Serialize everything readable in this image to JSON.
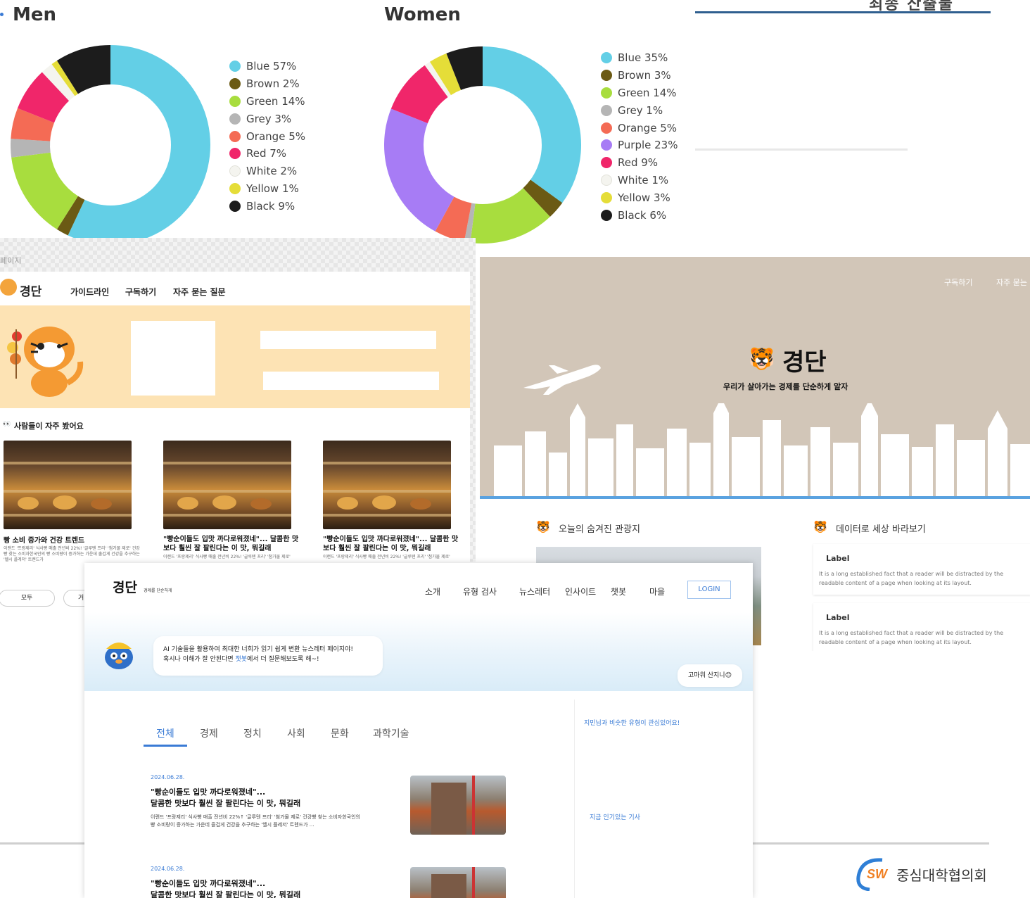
{
  "charts": {
    "men": {
      "title": "Men",
      "legend": [
        {
          "label": "Blue 57%",
          "color": "#63cfe6",
          "value": 57
        },
        {
          "label": "Brown 2%",
          "color": "#6b5a14",
          "value": 2
        },
        {
          "label": "Green 14%",
          "color": "#a8dd3e",
          "value": 14
        },
        {
          "label": "Grey 3%",
          "color": "#b5b5b5",
          "value": 3
        },
        {
          "label": "Orange 5%",
          "color": "#f46b55",
          "value": 5
        },
        {
          "label": "Red 7%",
          "color": "#f0266a",
          "value": 7
        },
        {
          "label": "White 2%",
          "color": "#f4f4ef",
          "value": 2
        },
        {
          "label": "Yellow 1%",
          "color": "#e5dd38",
          "value": 1
        },
        {
          "label": "Black 9%",
          "color": "#1c1c1c",
          "value": 9
        }
      ]
    },
    "women": {
      "title": "Women",
      "legend": [
        {
          "label": "Blue 35%",
          "color": "#63cfe6",
          "value": 35
        },
        {
          "label": "Brown 3%",
          "color": "#6b5a14",
          "value": 3
        },
        {
          "label": "Green 14%",
          "color": "#a8dd3e",
          "value": 14
        },
        {
          "label": "Grey 1%",
          "color": "#b5b5b5",
          "value": 1
        },
        {
          "label": "Orange 5%",
          "color": "#f46b55",
          "value": 5
        },
        {
          "label": "Purple 23%",
          "color": "#a77cf5",
          "value": 23
        },
        {
          "label": "Red 9%",
          "color": "#f0266a",
          "value": 9
        },
        {
          "label": "White 1%",
          "color": "#f4f4ef",
          "value": 1
        },
        {
          "label": "Yellow 3%",
          "color": "#e5dd38",
          "value": 3
        },
        {
          "label": "Black 6%",
          "color": "#1c1c1c",
          "value": 6
        }
      ]
    },
    "top_right_title": "최종 산출물"
  },
  "chart_data": [
    {
      "type": "pie",
      "title": "Men",
      "categories": [
        "Blue",
        "Brown",
        "Green",
        "Grey",
        "Orange",
        "Red",
        "White",
        "Yellow",
        "Black"
      ],
      "values": [
        57,
        2,
        14,
        3,
        5,
        7,
        2,
        1,
        9
      ],
      "legend": "right"
    },
    {
      "type": "pie",
      "title": "Women",
      "categories": [
        "Blue",
        "Brown",
        "Green",
        "Grey",
        "Orange",
        "Purple",
        "Red",
        "White",
        "Yellow",
        "Black"
      ],
      "values": [
        35,
        3,
        14,
        1,
        5,
        23,
        9,
        1,
        3,
        6
      ],
      "legend": "right"
    }
  ],
  "left_mock": {
    "page_label": "페이지",
    "logo": "경단",
    "nav": [
      "가이드라인",
      "구독하기",
      "자주 묻는 질문"
    ],
    "section_title": "사람들이 자주 봤어요",
    "cards": [
      {
        "title": "빵 소비 증가와 건강 트렌드",
        "desc": "이랜드 '프랑제리' 식사빵 매출 전년비 22%! '글루텐 프리' '첨가물 제로' 건강빵 찾는 소비자한국인의 빵 소비량이 증가하는 가운데 출겁게 건강을 추구하는 '헬시 플레저' 트렌드가"
      },
      {
        "title": "\"빵순이들도 입맛 까다로워졌네\"... 달콤한 맛보다 훨씬 잘 팔린다는 이 맛, 뭐길래",
        "desc": "이랜드 '프랑제리' 식사빵 매출 전년비 22%! '글루텐 프리' '첨가물 제로'"
      },
      {
        "title": "\"빵순이들도 입맛 까다로워졌네\"... 달콤한 맛보다 훨씬 잘 팔린다는 이 맛, 뭐길래",
        "desc": "이랜드 '프랑제리' 식사빵 매출 전년비 22%! '글루텐 프리' '첨가물 제로'"
      }
    ],
    "tabs": [
      "모두",
      "거"
    ]
  },
  "right_mock": {
    "nav": [
      "구독하기",
      "자주 묻는"
    ],
    "logo": "경단",
    "tagline": "우리가 살아가는 경제를 단순하게 알자",
    "section_left": "오늘의 숨겨진 관광지",
    "section_right": "데이터로 세상 바라보기",
    "label_cards": [
      {
        "label": "Label",
        "text": "It is a long established fact that a reader will be distracted by the readable content of a page when looking at its layout."
      },
      {
        "label": "Label",
        "text": "It is a long established fact that a reader will be distracted by the readable content of a page when looking at its layout."
      }
    ]
  },
  "bottom_mock": {
    "logo": "경단",
    "logo_sub": "경제를 단순하게",
    "nav": [
      "소개",
      "유형 검사",
      "뉴스레터",
      "인사이트",
      "챗봇",
      "마을"
    ],
    "login": "LOGIN",
    "bubble_line1": "AI 기술들을 활용하여 최대한 너희가 읽기 쉽게 변환 뉴스레터 페이지야!",
    "bubble_line2_pre": "혹시나 이해가 잘 안된다면 ",
    "bubble_link": "챗봇",
    "bubble_line2_post": "에서 더 질문해보도록 해~!",
    "thanks_button": "고마워 산지니😊",
    "categories": [
      "전체",
      "경제",
      "정치",
      "사회",
      "문화",
      "과학기술"
    ],
    "articles": [
      {
        "date": "2024.06.28.",
        "title1": "\"빵순이들도 입맛 까다로워졌네\"...",
        "title2": "달콤한 맛보다 훨씬 잘 팔린다는 이 맛, 뭐길래",
        "desc1": "이랜드 '프랑제리' 식사빵 매출 전년비 22%↑ '글루텐 프리' '첨가물 제로' 건강빵 찾는 소비자한국인의",
        "desc2": "빵 소비량이 증가하는 가운데 즐겁게 건강을 추구하는 '헬시 플레저' 트렌드가 ..."
      },
      {
        "date": "2024.06.28.",
        "title1": "\"빵순이들도 입맛 까다로워졌네\"...",
        "title2": "달콤한 맛보다 훨씬 잘 팔린다는 이 맛, 뭐길래",
        "desc1": "",
        "desc2": ""
      }
    ],
    "side_link1": "지민님과 비슷한 유형이 관심있어요!",
    "side_link2": "지금 인기있는 기사"
  },
  "footer": {
    "logo_mark": "SW",
    "org": "중심대학협의회"
  }
}
